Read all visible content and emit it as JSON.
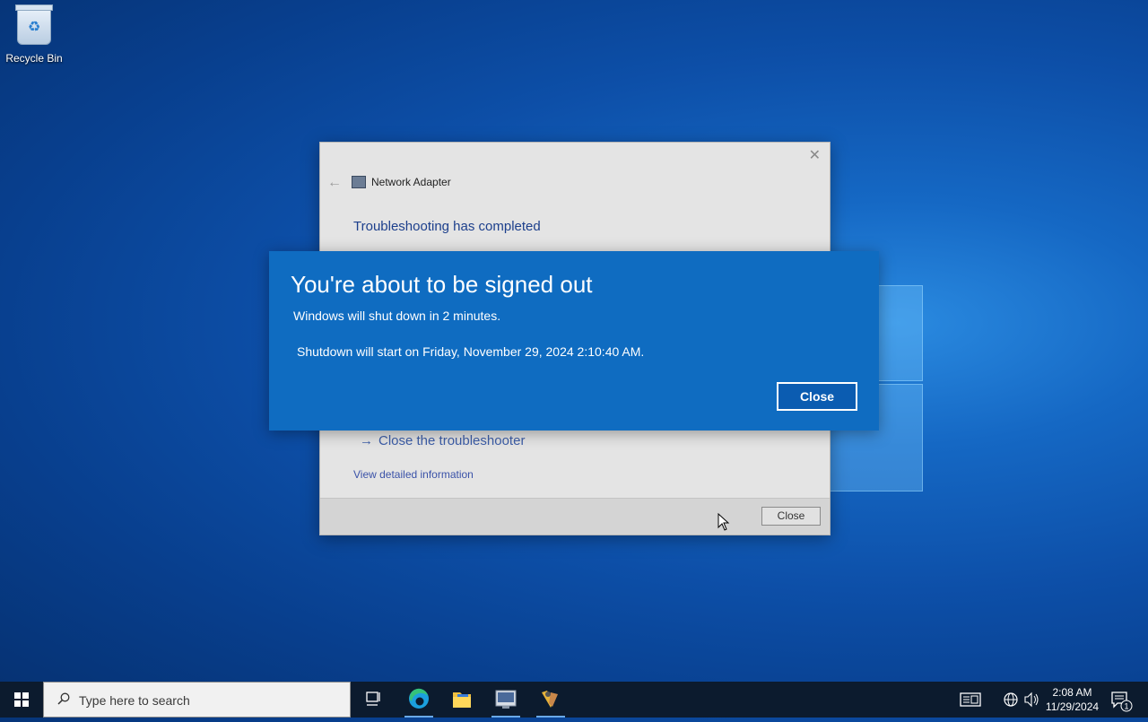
{
  "desktop": {
    "recycle_bin_label": "Recycle Bin"
  },
  "troubleshooter": {
    "window_title": "Network Adapter",
    "heading": "Troubleshooting has completed",
    "action_label": "Close the troubleshooter",
    "detail_link": "View detailed information",
    "close_button": "Close"
  },
  "shutdown_notice": {
    "title": "You're about to be signed out",
    "message": "Windows will shut down in 2 minutes.",
    "start_time": "Shutdown will start on Friday, November 29, 2024 2:10:40 AM.",
    "close_button": "Close"
  },
  "taskbar": {
    "search_placeholder": "Type here to search",
    "apps": [
      "task-view-icon",
      "edge-icon",
      "file-explorer-icon",
      "troubleshooter-icon",
      "tools-icon"
    ],
    "clock_time": "2:08 AM",
    "clock_date": "11/29/2024",
    "notification_count": "1"
  },
  "colors": {
    "banner": "#0f6cc1",
    "taskbar": "#0c1b2e",
    "link": "#3a52a8"
  }
}
